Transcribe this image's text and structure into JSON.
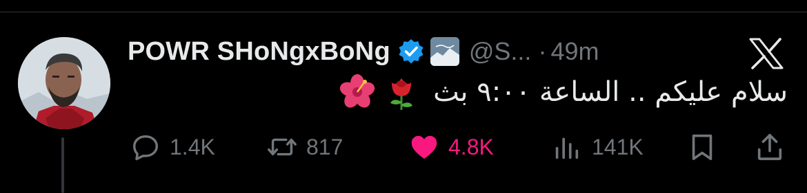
{
  "tweet": {
    "author": {
      "display_name": "POWR SHoNgxBoNg",
      "handle": "@S...",
      "verified": true,
      "verified_color": "#1d9bf0"
    },
    "separator": "·",
    "timestamp": "49m",
    "text": "سلام عليكم .. الساعة ٩:٠٠ بث",
    "emojis": [
      "rose-emoji",
      "hibiscus-emoji"
    ],
    "actions": {
      "replies": "1.4K",
      "reposts": "817",
      "likes": "4.8K",
      "views": "141K"
    },
    "liked": true,
    "like_color": "#f91880",
    "muted_color": "#71767b"
  },
  "app": {
    "logo": "x-logo-icon"
  }
}
